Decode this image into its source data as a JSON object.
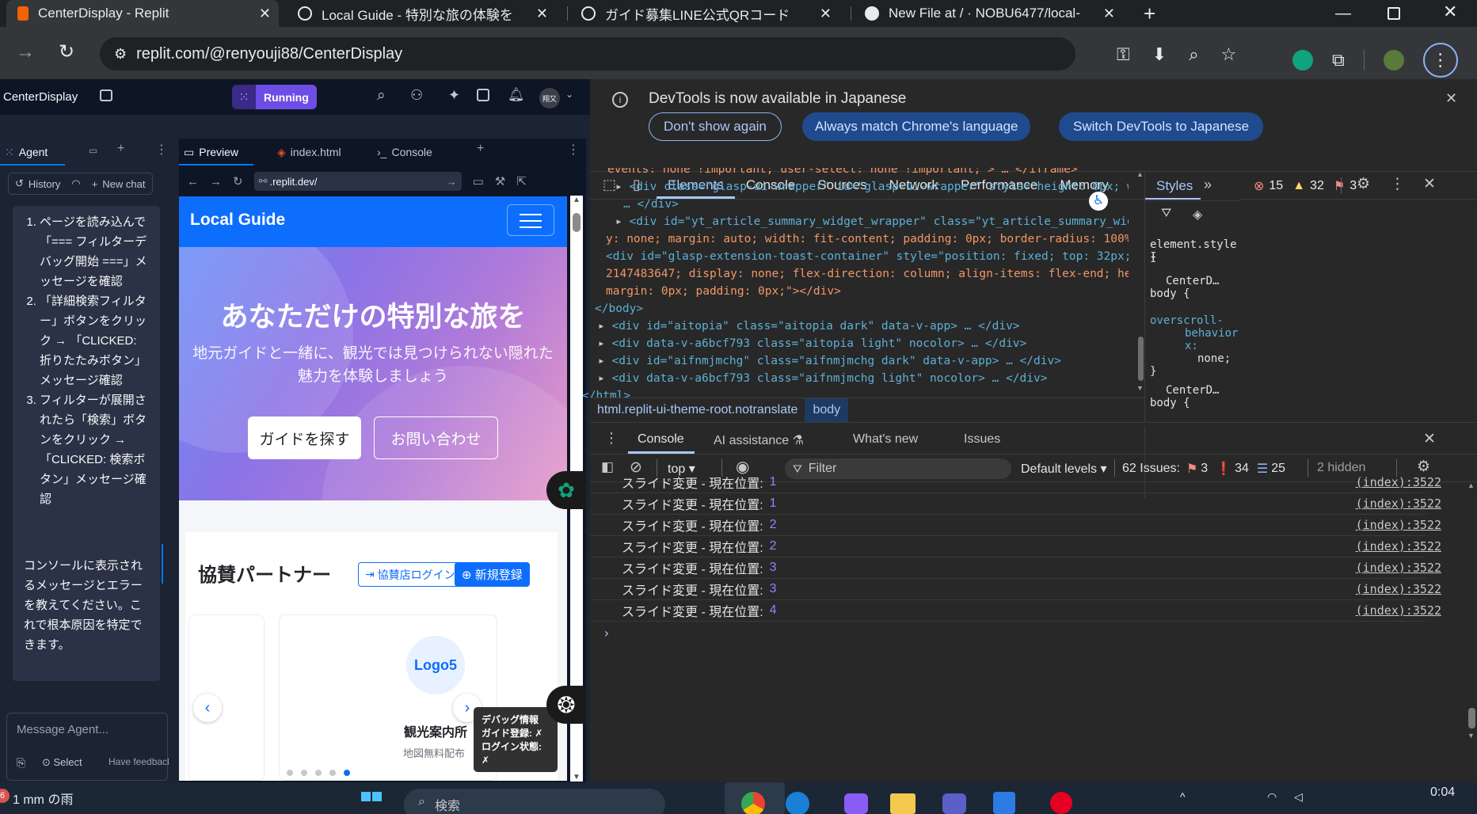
{
  "browser": {
    "tabs": [
      {
        "title": "CenterDisplay - Replit",
        "active": true
      },
      {
        "title": "Local Guide - 特別な旅の体験を"
      },
      {
        "title": "ガイド募集LINE公式QRコード"
      },
      {
        "title": "New File at / · NOBU6477/local-"
      }
    ],
    "new_tab": "+",
    "url": "replit.com/@renyouji88/CenterDisplay"
  },
  "replit": {
    "project": "CenterDisplay",
    "run_label": "Running",
    "avatar_text": "翔又",
    "panel_tabs": [
      "Agent",
      "Preview",
      "index.html",
      "Console"
    ],
    "history": "History",
    "new_chat": "New chat",
    "preview_url": ".replit.dev/",
    "agent_steps": [
      "ページを読み込んで「=== フィルターデバッグ開始 ===」メッセージを確認",
      "「詳細検索フィルター」ボタンをクリック → 「CLICKED: 折りたたみボタン」メッセージ確認",
      "フィルターが展開されたら「検索」ボタンをクリック → 「CLICKED: 検索ボタン」メッセージ確認"
    ],
    "agent_note": "コンソールに表示されるメッセージとエラーを教えてください。これで根本原因を特定できます。",
    "message_placeholder": "Message Agent...",
    "select_label": "Select",
    "feedback_label": "Have feedback"
  },
  "site": {
    "brand": "Local Guide",
    "hero_title": "あなただけの特別な旅を",
    "hero_sub": "地元ガイドと一緒に、観光では見つけられない隠れた魅力を体験しましょう",
    "btn_find": "ガイドを探す",
    "btn_contact": "お問い合わせ",
    "partners_title": "協賛パートナー",
    "partner_login": "協賛店ログイン",
    "partner_register": "新規登録",
    "logo": "Logo5",
    "card_title": "観光案内所",
    "card_sub": "地図無料配布",
    "debug_title": "デバッグ情報",
    "debug_guide": "ガイド登録: ✗",
    "debug_login": "ログイン状態: ✗"
  },
  "devtools": {
    "banner": "DevTools is now available in Japanese",
    "banner_btns": [
      "Don't show again",
      "Always match Chrome's language",
      "Switch DevTools to Japanese"
    ],
    "tabs": [
      "Elements",
      "Console",
      "Sources",
      "Network",
      "Performance",
      "Memory"
    ],
    "errors": "15",
    "warnings": "32",
    "issues": "3",
    "dom_lines": [
      "events: none !important; user-select: none !important;\"> … </iframe>",
      "<div class=\"glasp-ui-wrapper\" id=\"glasp-ui-wrapper\" style=\"height: 0px; width: 0px; padding: 0px;\">",
      "… </div>",
      "<div id=\"yt_article_summary_widget_wrapper\" class=\"yt_article_summary_widget_wrapper\" style=\"displa",
      "y: none; margin: auto; width: fit-content; padding: 0px; border-radius: 100%;\"> … </div>",
      "<div id=\"glasp-extension-toast-container\" style=\"position: fixed; top: 32px; right: 16px; z-index:",
      "2147483647; display: none; flex-direction: column; align-items: flex-end; height: 0px; width: auto;",
      "margin: 0px; padding: 0px;\"></div>",
      "</body>",
      "<div id=\"aitopia\" class=\"aitopia dark\" data-v-app> … </div>",
      "<div data-v-a6bcf793 class=\"aitopia light\" nocolor> … </div>",
      "<div id=\"aifnmjmchg\" class=\"aifnmjmchg dark\" data-v-app> … </div>",
      "<div data-v-a6bcf793 class=\"aifnmjmchg light\" nocolor> … </div>",
      "</html>"
    ],
    "breadcrumb": [
      "html.replit-ui-theme-root.notranslate",
      "body"
    ],
    "styles_tab": "Styles",
    "styles_lines": [
      "element.style {",
      "}",
      "CenterD…",
      "body {",
      "overscroll-",
      "behavior-",
      "x:",
      "none;",
      "}",
      "CenterD…",
      "body {"
    ],
    "drawer_tabs": [
      "Console",
      "AI assistance",
      "What's new",
      "Issues"
    ],
    "context": "top",
    "filter_placeholder": "Filter",
    "levels": "Default levels",
    "issues_summary": "62 Issues:",
    "issue_counts": [
      "3",
      "34",
      "25"
    ],
    "hidden": "2 hidden",
    "console_rows": [
      {
        "msg": "スライド変更 - 現在位置:",
        "n": "1",
        "src": "(index):3522"
      },
      {
        "msg": "スライド変更 - 現在位置:",
        "n": "1",
        "src": "(index):3522"
      },
      {
        "msg": "スライド変更 - 現在位置:",
        "n": "2",
        "src": "(index):3522"
      },
      {
        "msg": "スライド変更 - 現在位置:",
        "n": "2",
        "src": "(index):3522"
      },
      {
        "msg": "スライド変更 - 現在位置:",
        "n": "3",
        "src": "(index):3522"
      },
      {
        "msg": "スライド変更 - 現在位置:",
        "n": "3",
        "src": "(index):3522"
      },
      {
        "msg": "スライド変更 - 現在位置:",
        "n": "4",
        "src": "(index):3522"
      }
    ],
    "prompt": "›"
  },
  "taskbar": {
    "weather": "1 mm の雨",
    "weather_badge": "6",
    "search": "検索",
    "time": "0:04"
  },
  "colors": {
    "replit_bg": "#1c2333",
    "accent_blue": "#0d6efd",
    "running": "#6c4de6",
    "devtools_bg": "#282828"
  }
}
